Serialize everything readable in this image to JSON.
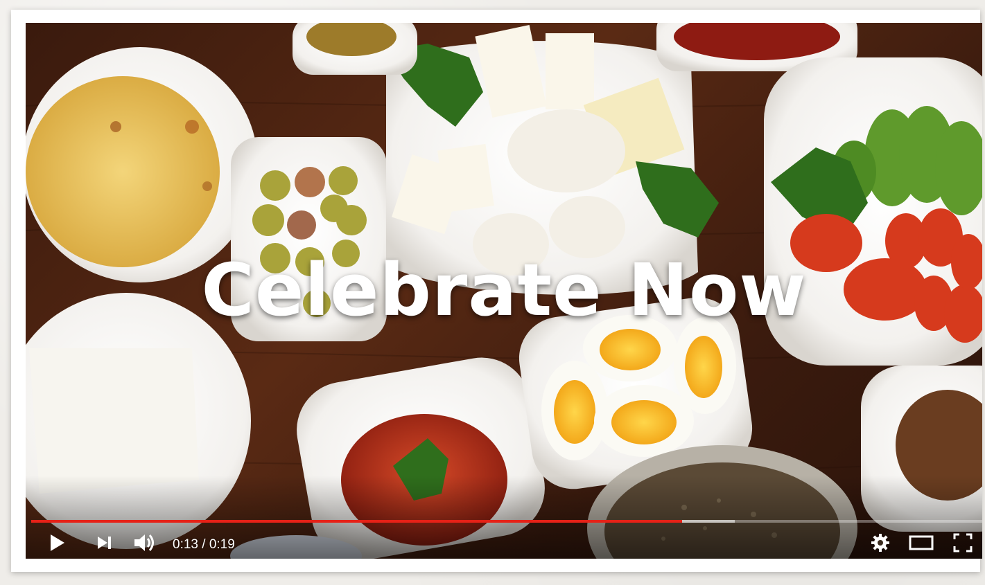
{
  "video": {
    "overlay_title": "Celebrate Now",
    "progress_fraction": 0.6842,
    "loaded_fraction": 0.74
  },
  "player": {
    "time_display": "0:13 / 0:19",
    "icons": {
      "play": "play-icon",
      "next": "next-icon",
      "volume": "volume-icon",
      "settings": "gear-icon",
      "theater": "theater-mode-icon",
      "fullscreen": "fullscreen-icon"
    },
    "accent_color": "#e62117"
  }
}
